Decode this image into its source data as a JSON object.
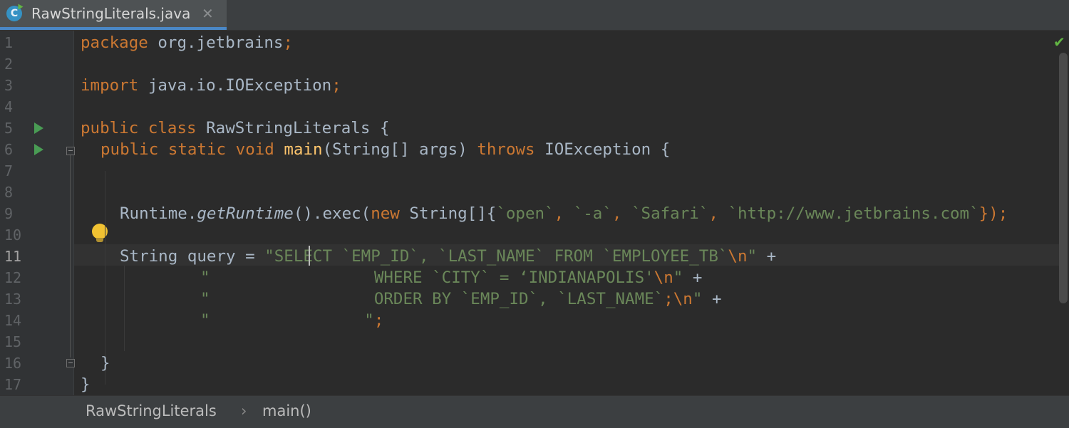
{
  "tab": {
    "icon_letter": "C",
    "title": "RawStringLiterals.java",
    "close_glyph": "✕"
  },
  "gutter": {
    "line_numbers": [
      "1",
      "2",
      "3",
      "4",
      "5",
      "6",
      "7",
      "8",
      "9",
      "10",
      "11",
      "12",
      "13",
      "14",
      "15",
      "16",
      "17"
    ],
    "current_line": "11"
  },
  "code": {
    "l1": {
      "kw": "package",
      "rest": " org.jetbrains",
      "semi": ";"
    },
    "l3": {
      "kw": "import",
      "rest": " java.io.IOException",
      "semi": ";"
    },
    "l5": {
      "kw": "public class",
      "rest": " RawStringLiterals {"
    },
    "l6": {
      "kw1": "public static void",
      "fn": "main",
      "mid": "(String[] args) ",
      "kw2": "throws",
      "rest": " IOException {"
    },
    "l9": {
      "p1": "Runtime.",
      "method": "getRuntime",
      "p2": "().exec(",
      "kw": "new",
      "p3": " String[]{",
      "s1": "`open`",
      "c1": ", ",
      "s2": "`-a`",
      "c2": ", ",
      "s3": "`Safari`",
      "c3": ", ",
      "s4": "`http://www.jetbrains.com`",
      "end": "});"
    },
    "l11": {
      "p1": "String query = ",
      "str": "\"SELECT `EMP_ID`, `LAST_NAME` FROM `EMPLOYEE_TB`",
      "esc": "\\n",
      "q": "\"",
      "plus": " +"
    },
    "l12": {
      "str": "\"                 WHERE `CITY` = ‘INDIANAPOLIS'",
      "esc": "\\n",
      "q": "\"",
      "plus": " +"
    },
    "l13": {
      "str": "\"                 ORDER BY `EMP_ID`, `LAST_NAME`",
      "semi": ";",
      "esc": "\\n",
      "q": "\"",
      "plus": " +"
    },
    "l14": {
      "str": "\"                ",
      "q": "\"",
      "semi": ";"
    },
    "l16": {
      "text": "}"
    },
    "l17": {
      "text": "}"
    }
  },
  "breadcrumb": {
    "items": [
      "RawStringLiterals",
      "main()"
    ],
    "separator": "›"
  },
  "status": {
    "inspection_glyph": "✔"
  },
  "colors": {
    "keyword": "#cc7832",
    "string": "#6a8759",
    "function": "#ffc66d",
    "text": "#a9b7c6",
    "background": "#2b2b2b"
  }
}
